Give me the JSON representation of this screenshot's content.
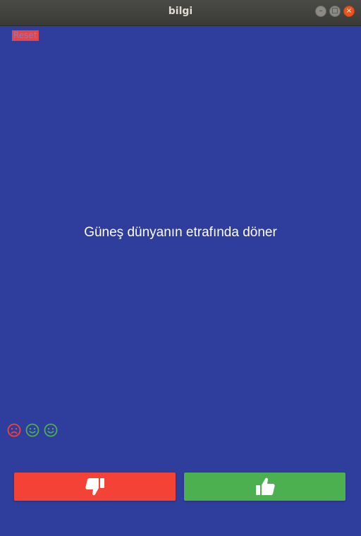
{
  "window": {
    "title": "bilgi",
    "controls": {
      "minimize": "–",
      "maximize": "□",
      "close": "×"
    }
  },
  "toolbar": {
    "reset_label": "Reset"
  },
  "question": {
    "text": "Güneş dünyanın etrafında döner"
  },
  "score_keeper": [
    {
      "icon": "sad-face-icon",
      "color": "#f44336"
    },
    {
      "icon": "smile-face-icon",
      "color": "#4caf50"
    },
    {
      "icon": "smile-face-icon",
      "color": "#4caf50"
    }
  ],
  "answers": {
    "false_button": {
      "icon": "thumbs-down-icon",
      "color": "#f44336"
    },
    "true_button": {
      "icon": "thumbs-up-icon",
      "color": "#4caf50"
    }
  },
  "colors": {
    "background": "#2f3d9c",
    "red": "#f44336",
    "green": "#4caf50"
  }
}
